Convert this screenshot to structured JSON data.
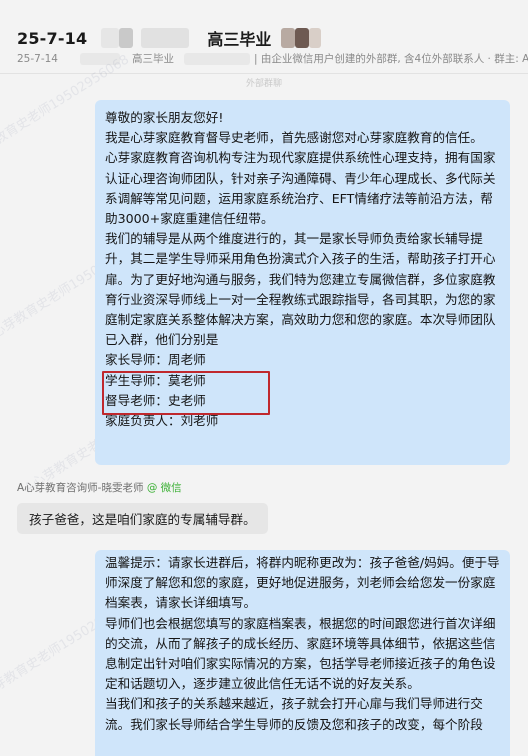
{
  "header": {
    "title_date": "25-7-14",
    "title_name": "高三毕业",
    "subtitle_date": "25-7-14",
    "subtitle_group": "高三毕业",
    "subtitle_info": "| 由企业微信用户创建的外部群, 含4位外部联系人 · 群主: A心芽"
  },
  "faded_label": "外部群聊",
  "watermark_text": "A心芽教育史老师19502956068",
  "messages": {
    "intro": {
      "paragraphs": [
        "尊敬的家长朋友您好!",
        "我是心芽家庭教育督导史老师，首先感谢您对心芽家庭教育的信任。",
        "心芽家庭教育咨询机构专注为现代家庭提供系统性心理支持，拥有国家认证心理咨询师团队，针对亲子沟通障碍、青少年心理成长、多代际关系调解等常见问题，运用家庭系统治疗、EFT情绪疗法等前沿方法，帮助3000+家庭重建信任纽带。",
        "我们的辅导是从两个维度进行的，其一是家长导师负责给家长辅导提升，其二是学生导师采用角色扮演式介入孩子的生活，帮助孩子打开心扉。为了更好地沟通与服务，我们特为您建立专属微信群，多位家庭教育行业资深导师线上一对一全程教练式跟踪指导，各司其职，为您的家庭制定家庭关系整体解决方案，高效助力您和您的家庭。本次导师团队已入群，他们分别是"
      ],
      "roles": [
        "家长导师：周老师",
        "学生导师：莫老师",
        "督导老师：史老师",
        "家庭负责人：刘老师"
      ]
    },
    "sender": {
      "name": "A心芽教育咨询师-晓雯老师",
      "platform": "@ 微信"
    },
    "reply": "孩子爸爸，这是咱们家庭的专属辅导群。",
    "tips": {
      "paragraphs": [
        "温馨提示：请家长进群后，将群内昵称更改为：孩子爸爸/妈妈。便于导师深度了解您和您的家庭，更好地促进服务，刘老师会给您发一份家庭档案表，请家长详细填写。",
        "导师们也会根据您填写的家庭档案表，根据您的时间跟您进行首次详细的交流，从而了解孩子的成长经历、家庭环境等具体细节，依据这些信息制定出针对咱们家实际情况的方案，包括学导老师接近孩子的角色设定和话题切入，逐步建立彼此信任无话不说的好友关系。",
        "当我们和孩子的关系越来越近，孩子就会打开心扉与我们导师进行交流。我们家长导师结合学生导师的反馈及您和孩子的改变，每个阶段"
      ]
    }
  },
  "colors": {
    "background": "#f3f3f3",
    "bubble_blue": "#cfe5fa",
    "bubble_gray": "#e6e6e6",
    "highlight_box": "#c0282d",
    "wechat_green": "#3cb035"
  }
}
